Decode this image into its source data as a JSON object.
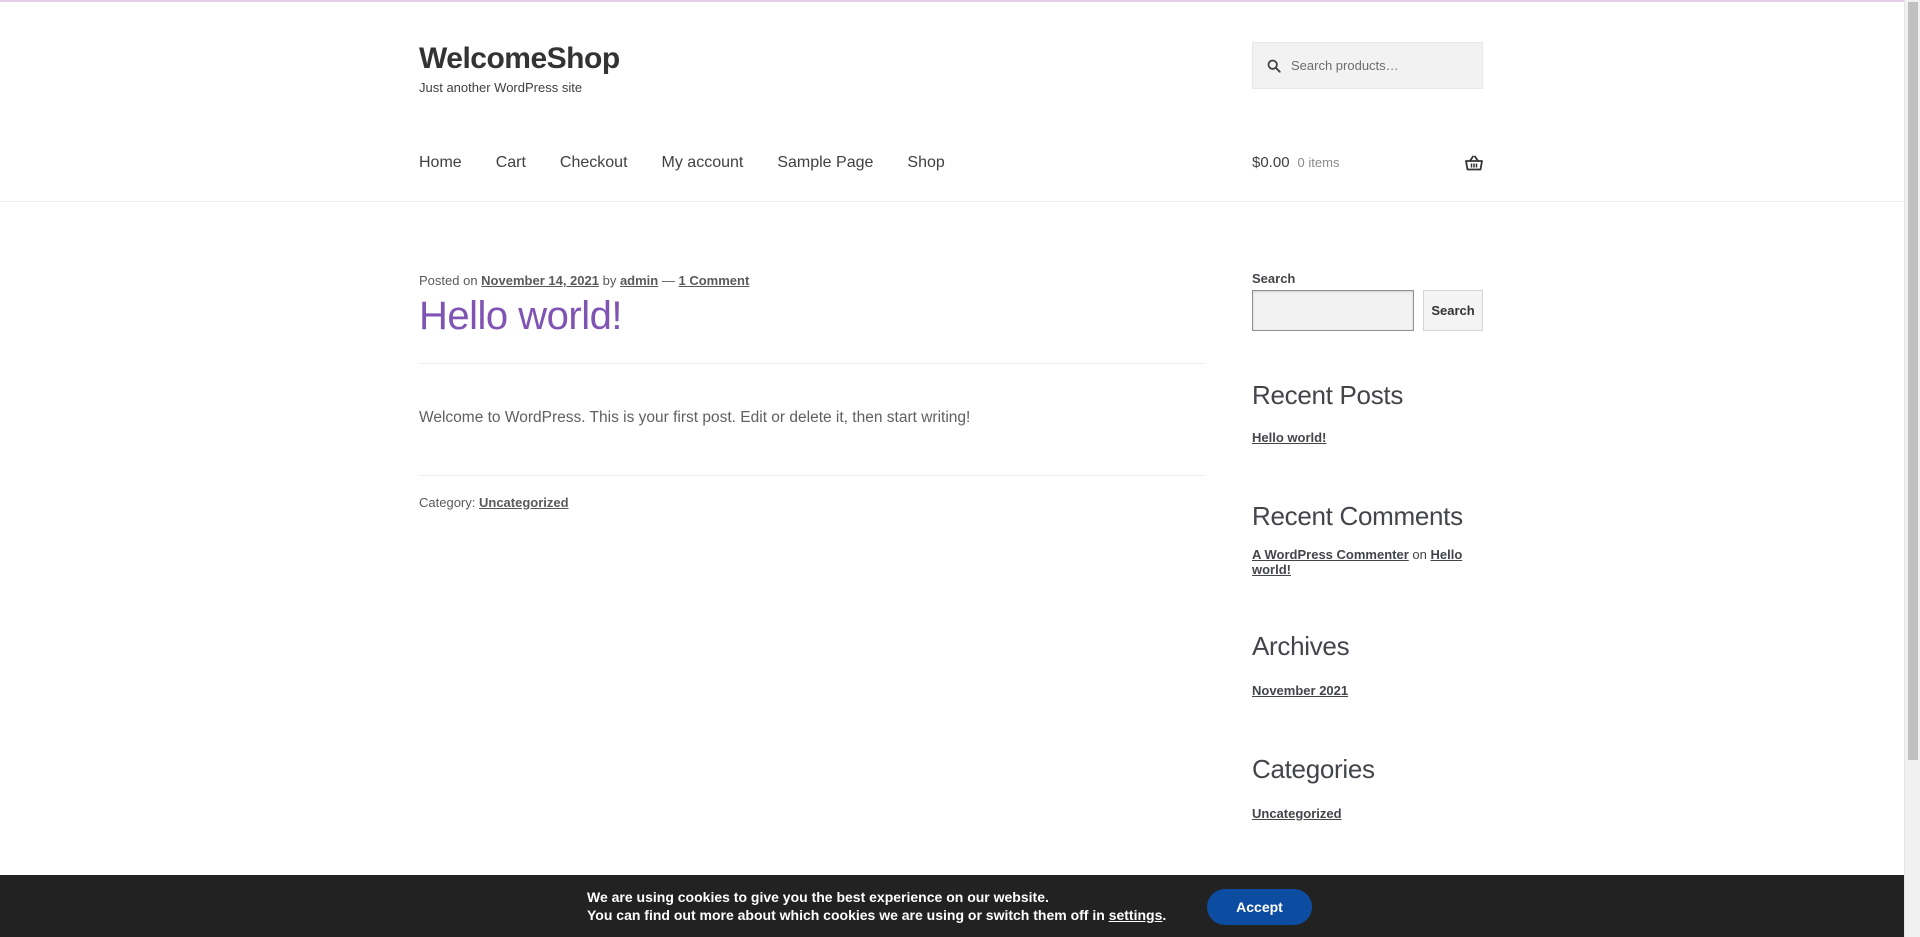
{
  "site": {
    "title": "WelcomeShop",
    "tagline": "Just another WordPress site"
  },
  "header_search": {
    "placeholder": "Search products…",
    "icon": "search-icon"
  },
  "nav": {
    "items": [
      {
        "label": "Home"
      },
      {
        "label": "Cart"
      },
      {
        "label": "Checkout"
      },
      {
        "label": "My account"
      },
      {
        "label": "Sample Page"
      },
      {
        "label": "Shop"
      }
    ]
  },
  "cart": {
    "amount": "$0.00",
    "count": "0 items",
    "icon": "basket-icon"
  },
  "post": {
    "meta_prefix": "Posted on",
    "date": "November 14, 2021",
    "by": "by",
    "author": "admin",
    "dash": "—",
    "comments": "1 Comment",
    "title": "Hello world!",
    "body": "Welcome to WordPress. This is your first post. Edit or delete it, then start writing!",
    "category_label": "Category:",
    "category": "Uncategorized",
    "title_color": "#7f54b3"
  },
  "sidebar": {
    "search_label": "Search",
    "search_button": "Search",
    "recent_posts": {
      "heading": "Recent Posts",
      "items": [
        "Hello world!"
      ]
    },
    "recent_comments": {
      "heading": "Recent Comments",
      "author": "A WordPress Commenter",
      "on": "on",
      "post": "Hello world!"
    },
    "archives": {
      "heading": "Archives",
      "items": [
        "November 2021"
      ]
    },
    "categories": {
      "heading": "Categories",
      "items": [
        "Uncategorized"
      ]
    }
  },
  "cookie_banner": {
    "line1": "We are using cookies to give you the best experience on our website.",
    "line2": "You can find out more about which cookies we are using or switch them off in",
    "settings_link": "settings",
    "period": ".",
    "accept": "Accept",
    "accept_color": "#0c4da2"
  }
}
